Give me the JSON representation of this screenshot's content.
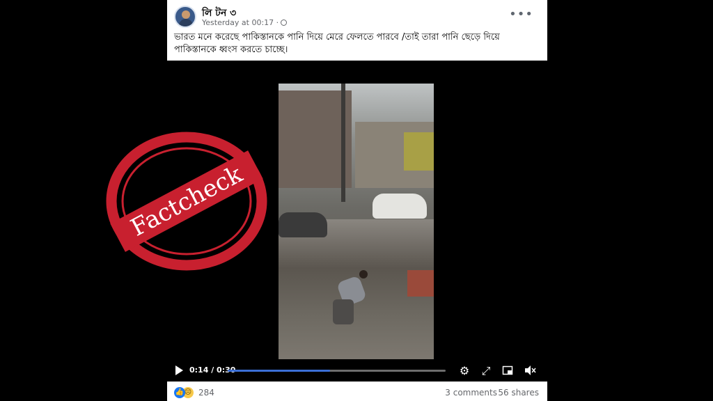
{
  "post": {
    "author": "লি টন ৩",
    "timestamp": "Yesterday at 00:17 ·",
    "caption": "ভারত মনে করেছে পাকিস্তানকে পানি দিয়ে মেরে ফেলতে পারবে /তাই তারা পানি ছেড়ে দিয়ে পাকিস্তানকে ধ্বংস করতে চাচ্ছে।",
    "more_icon": "more-options-icon"
  },
  "video": {
    "current_time": "0:14 / 0:30",
    "progress_fraction": 0.47,
    "icons": [
      "play-icon",
      "settings-icon",
      "fullscreen-icon",
      "pip-icon",
      "mute-icon"
    ]
  },
  "footer": {
    "reaction_count": "284",
    "comments": "3 comments",
    "shares": "56 shares",
    "reaction_icons": [
      "like-icon",
      "sad-icon"
    ]
  },
  "overlay": {
    "stamp_text": "Factcheck",
    "stamp_color": "#c8202f"
  }
}
